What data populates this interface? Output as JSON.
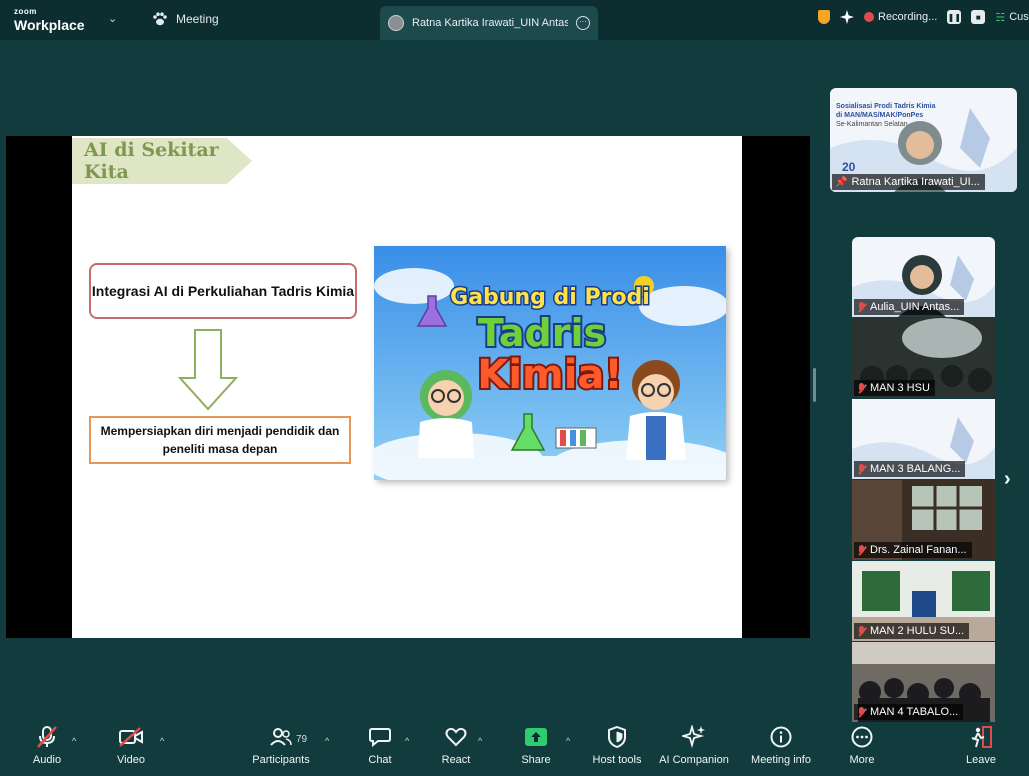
{
  "window": {
    "brand_top": "zoom",
    "brand_bottom": "Workplace",
    "meeting_tab": "Meeting",
    "active_tab_title": "Ratna Kartika Irawati_UIN Antasari",
    "recording_label": "Recording...",
    "right_cut_label": "Cust"
  },
  "slide": {
    "title": "AI di Sekitar Kita",
    "box1": "Integrasi AI di Perkuliahan Tadris Kimia",
    "box2_line1": "Mempersiapkan diri menjadi pendidik dan",
    "box2_line2": "peneliti masa depan",
    "poster_line1": "Gabung di Prodi",
    "poster_line2": "Tadris",
    "poster_line3": "Kimia!"
  },
  "pinned": {
    "name": "Ratna Kartika Irawati_UI...",
    "banner_title": "Sosialisasi Prodi Tadris Kimia",
    "banner_sub": "di MAN/MAS/MAK/PonPes",
    "banner_loc": "Se-Kalimantan Selatan",
    "banner_date": "20"
  },
  "participants": [
    {
      "name": "Aulia_UIN Antas..."
    },
    {
      "name": "MAN 3 HSU"
    },
    {
      "name": "MAN 3 BALANG..."
    },
    {
      "name": "Drs. Zainal Fanan..."
    },
    {
      "name": "MAN 2 HULU SU..."
    },
    {
      "name": "MAN 4 TABALO..."
    }
  ],
  "toolbar": {
    "audio": "Audio",
    "video": "Video",
    "participants": "Participants",
    "participants_count": "79",
    "chat": "Chat",
    "react": "React",
    "share": "Share",
    "host_tools": "Host tools",
    "ai_companion": "AI Companion",
    "meeting_info": "Meeting info",
    "more": "More",
    "leave": "Leave"
  },
  "colors": {
    "background": "#123b3d",
    "topbar": "#0d2e30",
    "share_green": "#2ecc71",
    "leave_red": "#e24b4b",
    "slide_title_green": "#7f9850"
  }
}
